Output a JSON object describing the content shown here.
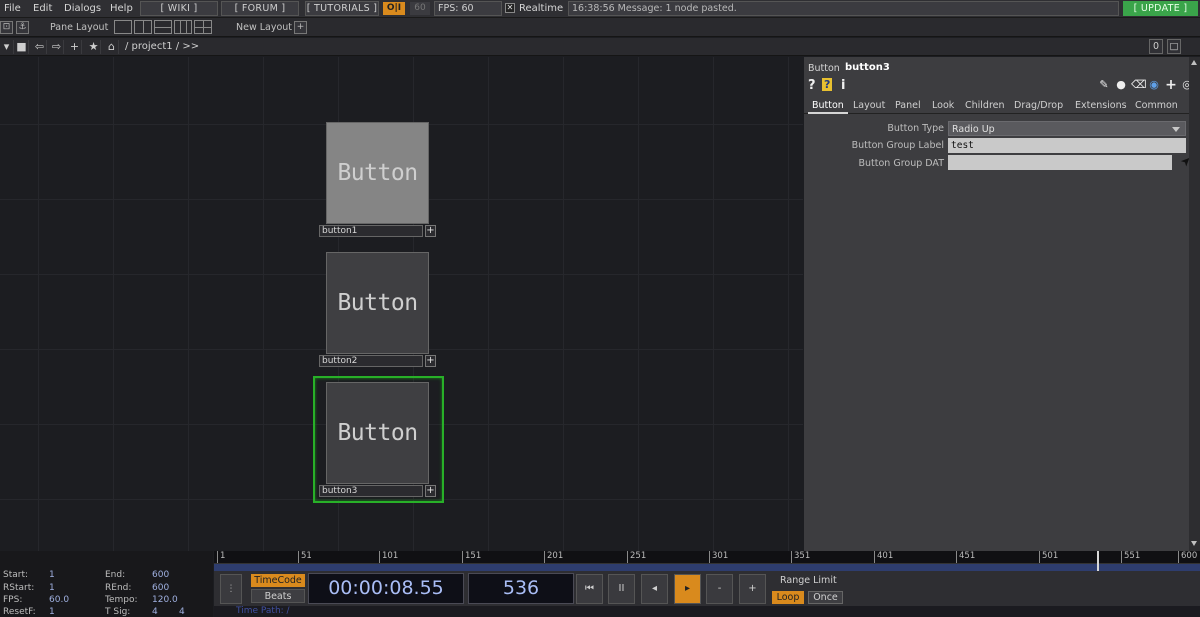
{
  "menu": {
    "file": "File",
    "edit": "Edit",
    "dialogs": "Dialogs",
    "help": "Help",
    "wiki": "[ WIKI ]",
    "forum": "[ FORUM ]",
    "tutorials": "[ TUTORIALS ]",
    "perf": "O|I",
    "fps_target": "60",
    "fps_label": "FPS:  60",
    "realtime_check": "✕",
    "realtime": "Realtime",
    "message": "16:38:56 Message: 1 node pasted.",
    "update": "[ UPDATE ]"
  },
  "layoutbar": {
    "pane_layout": "Pane Layout",
    "new_layout": "New Layout",
    "add": "+"
  },
  "pathbar": {
    "path": "/  project1  /  >>",
    "right_0": "0",
    "right_split": "□"
  },
  "nodes": [
    {
      "viewer_text": "Button",
      "name": "button1",
      "plus": "+",
      "viewer_bg": "#858585"
    },
    {
      "viewer_text": "Button",
      "name": "button2",
      "plus": "+",
      "viewer_bg": "#3f3f42"
    },
    {
      "viewer_text": "Button",
      "name": "button3",
      "plus": "+",
      "viewer_bg": "#3f3f42"
    }
  ],
  "params": {
    "op_type": "Button",
    "op_name": "button3",
    "help_q": "?",
    "python_help": "?",
    "info": "i",
    "tabs": [
      "Button",
      "Layout",
      "Panel",
      "Look",
      "Children",
      "Drag/Drop",
      "Extensions",
      "Common"
    ],
    "rows": [
      {
        "label": "Button Type",
        "value": "Radio Up"
      },
      {
        "label": "Button Group Label",
        "value": "test"
      },
      {
        "label": "Button Group DAT",
        "value": ""
      }
    ]
  },
  "ruler": {
    "ticks": [
      "1",
      "51",
      "101",
      "151",
      "201",
      "251",
      "301",
      "351",
      "401",
      "451",
      "501",
      "551",
      "600"
    ]
  },
  "info": {
    "start_k": "Start:",
    "start_v": "1",
    "rstart_k": "RStart:",
    "rstart_v": "1",
    "fps_k": "FPS:",
    "fps_v": "60.0",
    "resetf_k": "ResetF:",
    "resetf_v": "1",
    "end_k": "End:",
    "end_v": "600",
    "rend_k": "REnd:",
    "rend_v": "600",
    "tempo_k": "Tempo:",
    "tempo_v": "120.0",
    "tsig_k": "T Sig:",
    "tsig_v1": "4",
    "tsig_v2": "4"
  },
  "transport": {
    "timecode": "TimeCode",
    "beats": "Beats",
    "clock_time": "00:00:08.55",
    "clock_frame": "536",
    "rewind": "⏮",
    "pause": "II",
    "back": "◂",
    "play": "▸",
    "minus": "-",
    "plus": "+",
    "range_limit": "Range Limit",
    "loop": "Loop",
    "once": "Once",
    "time_path": "Time Path: /"
  },
  "colors": {
    "accent_orange": "#d98a1d",
    "selection_green": "#28b028",
    "update_green": "#3aa44a"
  }
}
